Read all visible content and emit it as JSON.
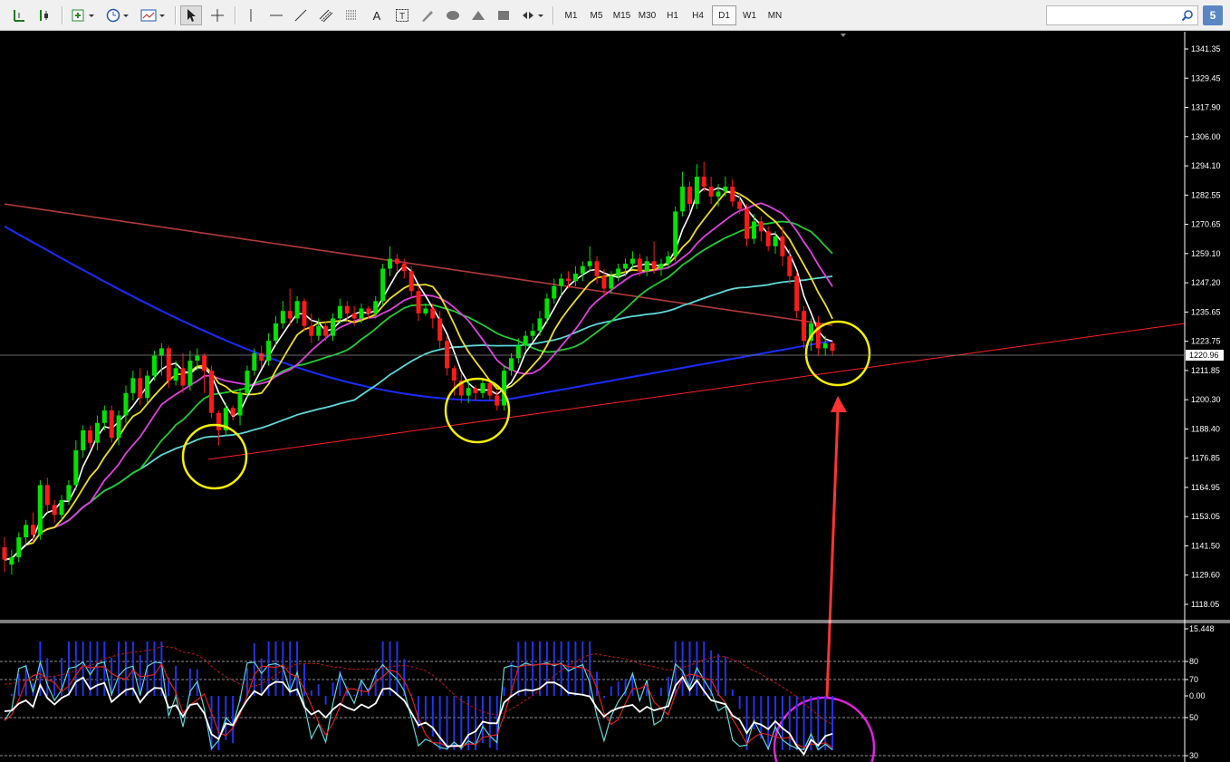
{
  "toolbar": {
    "timeframes": [
      "M1",
      "M5",
      "M15",
      "M30",
      "H1",
      "H4",
      "D1",
      "W1",
      "MN"
    ],
    "active_timeframe": "D1",
    "search_placeholder": "",
    "help_label": "5"
  },
  "chart_data": {
    "type": "candlestick",
    "timeframe": "D1",
    "price_axis_labels": [
      "1341.35",
      "1329.45",
      "1317.90",
      "1306.00",
      "1294.10",
      "1282.55",
      "1270.65",
      "1259.10",
      "1247.20",
      "1235.65",
      "1223.75",
      "1211.85",
      "1200.30",
      "1188.40",
      "1176.85",
      "1164.95",
      "1153.05",
      "1141.50",
      "1129.60",
      "1118.05"
    ],
    "current_price": "1220.96",
    "indicator_axis_labels": [
      "15.448",
      "80",
      "70",
      "0.00",
      "50",
      "30"
    ],
    "candles": [
      [
        1141,
        1136,
        1145,
        1131
      ],
      [
        1134,
        1137,
        1140,
        1130
      ],
      [
        1137,
        1145,
        1147,
        1135
      ],
      [
        1145,
        1150,
        1152,
        1142
      ],
      [
        1150,
        1146,
        1155,
        1143
      ],
      [
        1146,
        1166,
        1168,
        1144
      ],
      [
        1166,
        1158,
        1169,
        1155
      ],
      [
        1158,
        1154,
        1160,
        1151
      ],
      [
        1154,
        1160,
        1162,
        1152
      ],
      [
        1160,
        1166,
        1168,
        1158
      ],
      [
        1166,
        1180,
        1184,
        1164
      ],
      [
        1180,
        1188,
        1190,
        1177
      ],
      [
        1188,
        1183,
        1190,
        1181
      ],
      [
        1183,
        1191,
        1194,
        1180
      ],
      [
        1191,
        1196,
        1198,
        1188
      ],
      [
        1196,
        1185,
        1198,
        1183
      ],
      [
        1185,
        1194,
        1196,
        1182
      ],
      [
        1194,
        1203,
        1206,
        1191
      ],
      [
        1203,
        1209,
        1212,
        1200
      ],
      [
        1209,
        1201,
        1213,
        1198
      ],
      [
        1201,
        1210,
        1212,
        1199
      ],
      [
        1210,
        1218,
        1220,
        1208
      ],
      [
        1218,
        1221,
        1223,
        1210
      ],
      [
        1221,
        1208,
        1222,
        1205
      ],
      [
        1208,
        1213,
        1216,
        1206
      ],
      [
        1213,
        1206,
        1219,
        1203
      ],
      [
        1206,
        1216,
        1220,
        1204
      ],
      [
        1216,
        1218,
        1221,
        1212
      ],
      [
        1218,
        1212,
        1219,
        1203
      ],
      [
        1212,
        1195,
        1214,
        1193
      ],
      [
        1195,
        1188,
        1196,
        1182
      ],
      [
        1188,
        1197,
        1199,
        1186
      ],
      [
        1197,
        1194,
        1198,
        1192
      ],
      [
        1194,
        1203,
        1205,
        1190
      ],
      [
        1203,
        1212,
        1214,
        1201
      ],
      [
        1212,
        1219,
        1221,
        1210
      ],
      [
        1219,
        1216,
        1222,
        1213
      ],
      [
        1216,
        1224,
        1227,
        1214
      ],
      [
        1224,
        1231,
        1234,
        1222
      ],
      [
        1231,
        1236,
        1240,
        1229
      ],
      [
        1236,
        1233,
        1245,
        1230
      ],
      [
        1233,
        1240,
        1242,
        1231
      ],
      [
        1240,
        1230,
        1241,
        1228
      ],
      [
        1230,
        1226,
        1235,
        1223
      ],
      [
        1226,
        1230,
        1233,
        1224
      ],
      [
        1230,
        1226,
        1232,
        1224
      ],
      [
        1226,
        1233,
        1235,
        1224
      ],
      [
        1233,
        1238,
        1241,
        1231
      ],
      [
        1238,
        1235,
        1240,
        1232
      ],
      [
        1235,
        1233,
        1238,
        1230
      ],
      [
        1233,
        1237,
        1239,
        1231
      ],
      [
        1237,
        1235,
        1238,
        1233
      ],
      [
        1235,
        1240,
        1242,
        1233
      ],
      [
        1240,
        1253,
        1255,
        1238
      ],
      [
        1253,
        1257,
        1262,
        1250
      ],
      [
        1257,
        1255,
        1259,
        1252
      ],
      [
        1255,
        1252,
        1257,
        1249
      ],
      [
        1252,
        1244,
        1254,
        1241
      ],
      [
        1244,
        1235,
        1246,
        1232
      ],
      [
        1235,
        1237,
        1239,
        1234
      ],
      [
        1237,
        1233,
        1239,
        1229
      ],
      [
        1233,
        1224,
        1236,
        1221
      ],
      [
        1224,
        1213,
        1226,
        1210
      ],
      [
        1213,
        1208,
        1214,
        1202
      ],
      [
        1208,
        1202,
        1211,
        1199
      ],
      [
        1202,
        1205,
        1208,
        1199
      ],
      [
        1205,
        1203,
        1206,
        1200
      ],
      [
        1203,
        1207,
        1209,
        1201
      ],
      [
        1207,
        1202,
        1208,
        1200
      ],
      [
        1202,
        1198,
        1204,
        1196
      ],
      [
        1198,
        1212,
        1214,
        1196
      ],
      [
        1212,
        1217,
        1219,
        1210
      ],
      [
        1217,
        1222,
        1225,
        1215
      ],
      [
        1222,
        1226,
        1228,
        1220
      ],
      [
        1226,
        1228,
        1231,
        1224
      ],
      [
        1228,
        1233,
        1236,
        1226
      ],
      [
        1233,
        1241,
        1243,
        1231
      ],
      [
        1241,
        1246,
        1249,
        1239
      ],
      [
        1246,
        1249,
        1251,
        1242
      ],
      [
        1249,
        1248,
        1252,
        1245
      ],
      [
        1248,
        1251,
        1254,
        1246
      ],
      [
        1251,
        1254,
        1256,
        1248
      ],
      [
        1254,
        1256,
        1262,
        1252
      ],
      [
        1256,
        1250,
        1258,
        1247
      ],
      [
        1250,
        1245,
        1253,
        1242
      ],
      [
        1245,
        1250,
        1252,
        1243
      ],
      [
        1250,
        1253,
        1255,
        1248
      ],
      [
        1253,
        1255,
        1257,
        1250
      ],
      [
        1255,
        1257,
        1260,
        1253
      ],
      [
        1257,
        1252,
        1259,
        1250
      ],
      [
        1252,
        1256,
        1258,
        1250
      ],
      [
        1256,
        1253,
        1264,
        1251
      ],
      [
        1253,
        1255,
        1257,
        1250
      ],
      [
        1255,
        1258,
        1260,
        1253
      ],
      [
        1258,
        1276,
        1278,
        1256
      ],
      [
        1276,
        1286,
        1292,
        1274
      ],
      [
        1286,
        1279,
        1288,
        1276
      ],
      [
        1279,
        1290,
        1295,
        1277
      ],
      [
        1290,
        1286,
        1296,
        1284
      ],
      [
        1286,
        1282,
        1290,
        1279
      ],
      [
        1282,
        1284,
        1287,
        1278
      ],
      [
        1284,
        1286,
        1290,
        1282
      ],
      [
        1286,
        1280,
        1289,
        1278
      ],
      [
        1280,
        1277,
        1283,
        1275
      ],
      [
        1277,
        1265,
        1279,
        1262
      ],
      [
        1265,
        1272,
        1275,
        1263
      ],
      [
        1272,
        1268,
        1274,
        1264
      ],
      [
        1268,
        1262,
        1270,
        1260
      ],
      [
        1262,
        1266,
        1268,
        1259
      ],
      [
        1266,
        1258,
        1270,
        1254
      ],
      [
        1258,
        1250,
        1261,
        1247
      ],
      [
        1250,
        1236,
        1252,
        1233
      ],
      [
        1236,
        1224,
        1238,
        1221
      ],
      [
        1224,
        1231,
        1233,
        1220
      ],
      [
        1231,
        1221,
        1234,
        1218
      ],
      [
        1221,
        1223,
        1226,
        1218
      ],
      [
        1223,
        1220,
        1224,
        1218
      ]
    ]
  }
}
